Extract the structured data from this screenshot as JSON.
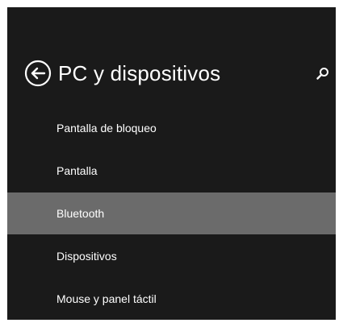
{
  "header": {
    "title": "PC y dispositivos",
    "back_icon": "back-arrow-circle-icon",
    "search_icon": "search-icon"
  },
  "nav": {
    "items": [
      {
        "label": "Pantalla de bloqueo",
        "selected": false
      },
      {
        "label": "Pantalla",
        "selected": false
      },
      {
        "label": "Bluetooth",
        "selected": true
      },
      {
        "label": "Dispositivos",
        "selected": false
      },
      {
        "label": "Mouse y panel táctil",
        "selected": false
      }
    ]
  },
  "colors": {
    "background": "#1a1a1a",
    "text": "#ffffff",
    "selected_background": "#6b6b6b"
  }
}
